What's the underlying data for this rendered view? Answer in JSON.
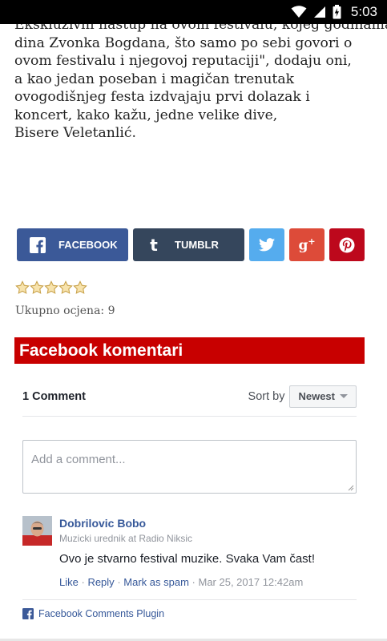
{
  "status_bar": {
    "time": "5:03"
  },
  "article": {
    "lines": [
      "Ekskluzivni nastup na ovom festivalu, kojeg godinama",
      "dina Zvonka Bogdana, što samo po sebi govori o",
      "ovom festivalu i njegovoj reputaciji\", dodaju oni,",
      "a kao jedan poseban i magičan trenutak",
      "ovogodišnjeg festa izdvajaju prvi dolazak i",
      "koncert, kako kažu, jedne velike dive,",
      "Bisere Veletanlić."
    ]
  },
  "share": {
    "facebook_label": "FACEBOOK",
    "tumblr_label": "TUMBLR",
    "colors": {
      "facebook": "#3b5998",
      "tumblr": "#35465c",
      "twitter": "#55acee",
      "googleplus": "#dd4b39",
      "pinterest": "#bd081c"
    }
  },
  "rating": {
    "stars": 5,
    "filled": 0,
    "label": "Ukupno ocjena: 9"
  },
  "section": {
    "title": "Facebook komentari",
    "color": "#c80000"
  },
  "comments_plugin": {
    "count_label": "1 Comment",
    "sort_label": "Sort by",
    "sort_value": "Newest",
    "input_placeholder": "Add a comment...",
    "comments": [
      {
        "author": "Dobrilovic Bobo",
        "role": "Muzicki urednik at Radio Niksic",
        "text": "Ovo je stvarno festival muzike. Svaka Vam čast!",
        "actions": {
          "like": "Like",
          "reply": "Reply",
          "spam": "Mark as spam",
          "timestamp": "Mar 25, 2017 12:42am"
        }
      }
    ],
    "footer": "Facebook Comments Plugin"
  }
}
